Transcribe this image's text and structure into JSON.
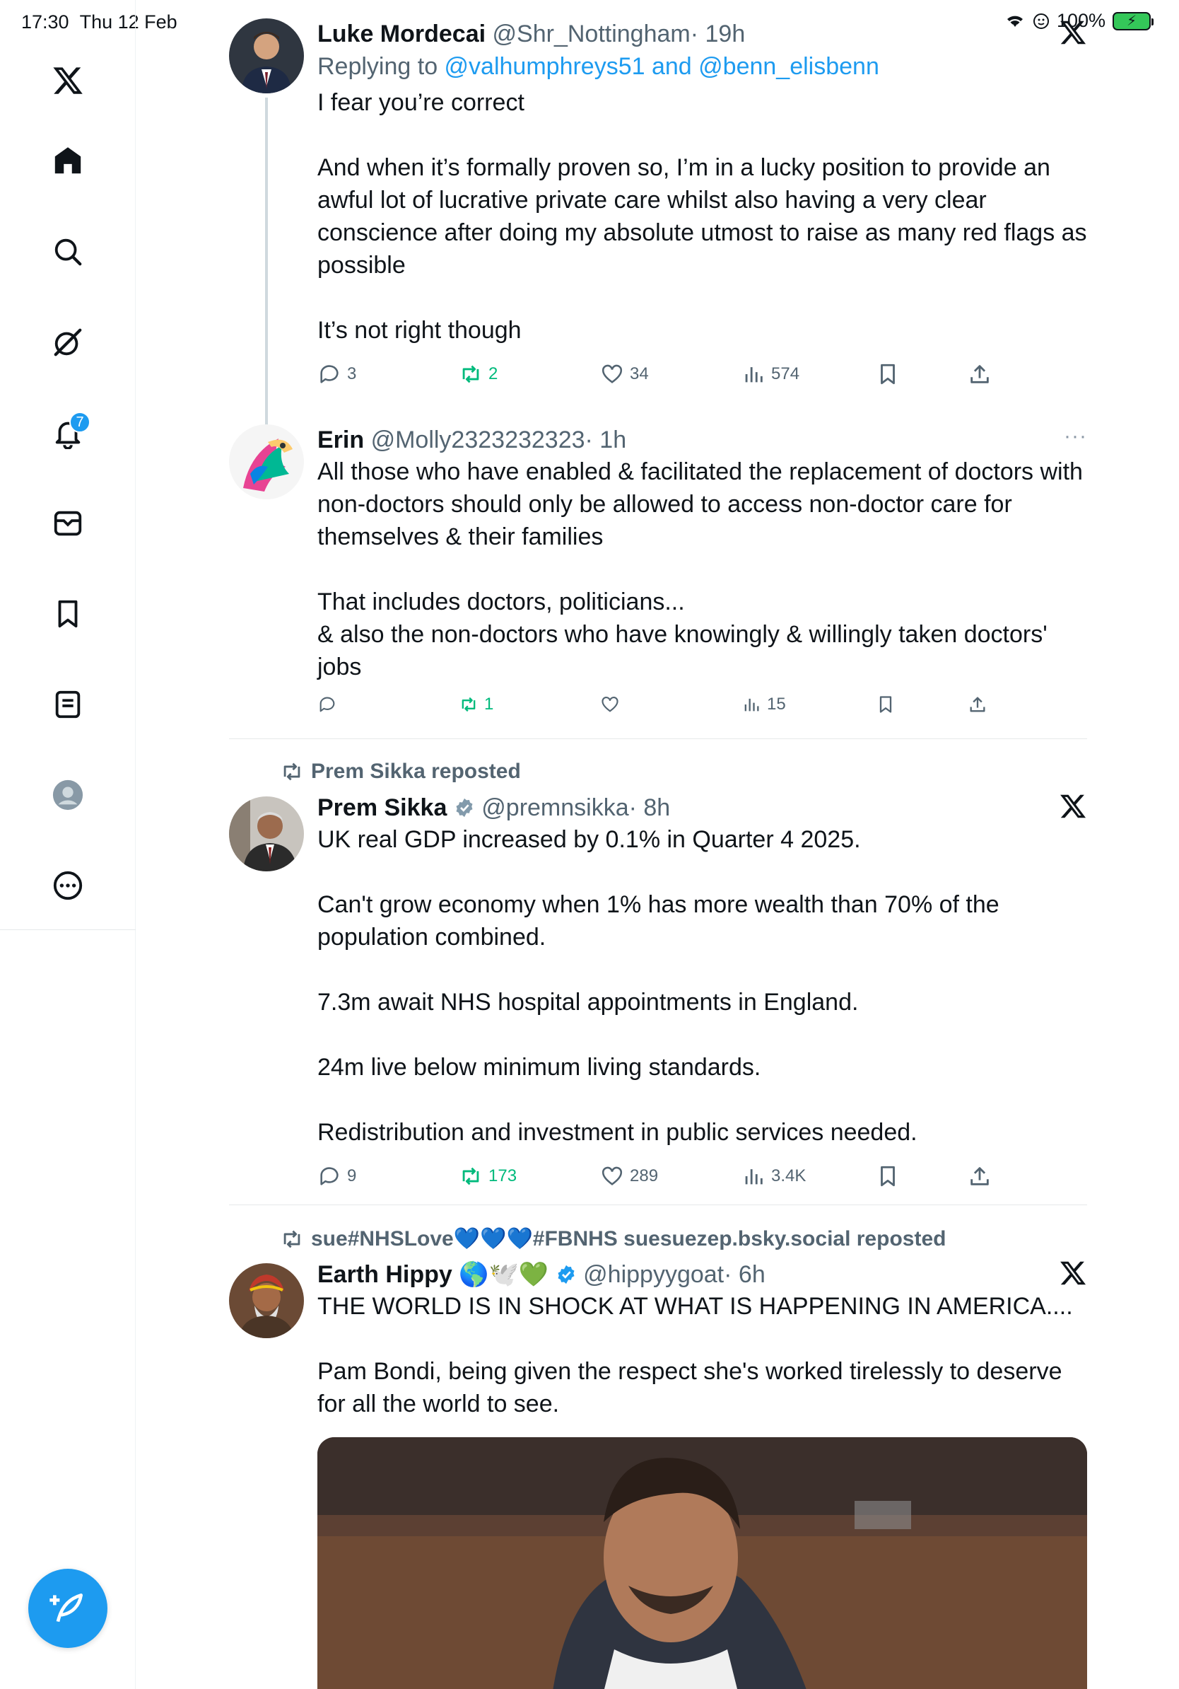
{
  "status": {
    "time": "17:30",
    "date": "Thu 12 Feb",
    "battery": "100%"
  },
  "sidebar": {
    "items": [
      {
        "name": "x-logo-icon"
      },
      {
        "name": "home-icon"
      },
      {
        "name": "search-icon"
      },
      {
        "name": "grok-icon"
      },
      {
        "name": "notifications-icon",
        "badge": "7"
      },
      {
        "name": "messages-icon"
      },
      {
        "name": "bookmarks-icon"
      },
      {
        "name": "lists-icon"
      },
      {
        "name": "profile-icon"
      },
      {
        "name": "more-icon"
      }
    ]
  },
  "tweets": [
    {
      "name": "Luke Mordecai",
      "handle": "@Shr_Nottingham",
      "time": "· 19h",
      "reply_prefix": "Replying to ",
      "reply_users": "@valhumphreys51 and @benn_elisbenn",
      "text": "I fear you’re correct\n\nAnd when it’s formally proven so, I’m in a lucky position to provide an awful lot of lucrative private care whilst also having a very clear conscience after doing my absolute utmost to raise as many red flags as possible\n\nIt’s not right though",
      "replies": "3",
      "reposts": "2",
      "likes": "34",
      "views": "574"
    },
    {
      "name": "Erin",
      "handle": "@Molly2323232323",
      "time": "· 1h",
      "more": "···",
      "text": "All those who have enabled & facilitated the replacement of doctors with non-doctors should only be allowed to access non-doctor care for themselves & their families\n\nThat includes doctors, politicians...\n& also the non-doctors who have knowingly & willingly taken doctors' jobs",
      "replies": "",
      "reposts": "1",
      "likes": "",
      "views": "15"
    },
    {
      "repost_by": "Prem Sikka reposted",
      "name": "Prem Sikka",
      "handle": "@premnsikka",
      "time": "· 8h",
      "text": "UK real GDP increased by 0.1% in Quarter 4 2025.\n\nCan't grow economy when 1% has more wealth than 70% of the population combined.\n\n7.3m await NHS hospital appointments in England.\n\n24m live below minimum living standards.\n\nRedistribution and investment in public services needed.",
      "replies": "9",
      "reposts": "173",
      "likes": "289",
      "views": "3.4K"
    },
    {
      "repost_by": "sue#NHSLove💙💙💙#FBNHS suesuezep.bsky.social reposted",
      "name": "Earth Hippy 🌎🕊️💚",
      "handle": "@hippyygoat",
      "time": "· 6h",
      "text": "THE WORLD IS IN SHOCK AT WHAT IS HAPPENING IN AMERICA....\n\nPam Bondi, being given the respect she's worked tirelessly to deserve for all the world to see."
    }
  ],
  "colors": {
    "accent": "#1d9bf0",
    "repost": "#00ba7c",
    "muted": "#536471"
  }
}
